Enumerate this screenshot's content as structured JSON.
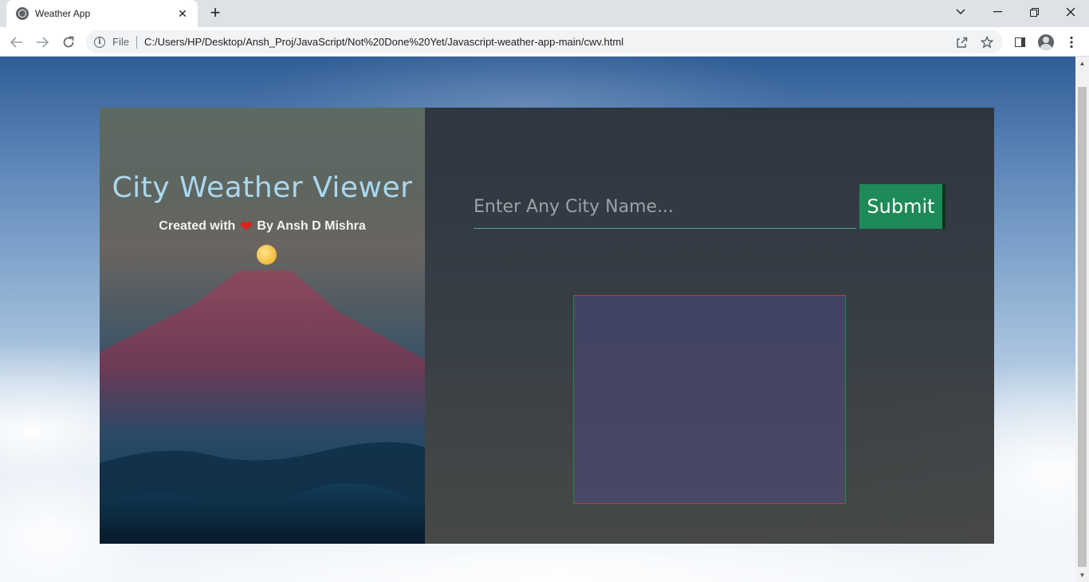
{
  "browser": {
    "tab_title": "Weather App",
    "new_tab_glyph": "+",
    "close_glyph": "✕",
    "file_label": "File",
    "url": "C:/Users/HP/Desktop/Ansh_Proj/JavaScript/Not%20Done%20Yet/Javascript-weather-app-main/cwv.html",
    "icons": [
      "globe-icon",
      "back-arrow-icon",
      "forward-arrow-icon",
      "reload-icon",
      "info-icon",
      "share-icon",
      "star-icon",
      "side-panel-icon",
      "profile-icon",
      "more-vert-icon",
      "chevron-down-icon",
      "minimize-icon",
      "restore-icon",
      "close-icon"
    ]
  },
  "app": {
    "title": "City Weather Viewer",
    "credit_prefix": "Created with",
    "credit_suffix": "By Ansh D Mishra",
    "heart_glyph": "❤",
    "search": {
      "placeholder": "Enter Any City Name...",
      "value": ""
    },
    "submit_label": "Submit"
  },
  "colors": {
    "title": "#a9d8ef",
    "submit_bg": "#1e8a57",
    "input_underline": "#4fa3a3",
    "result_border": "#c83c3c"
  }
}
